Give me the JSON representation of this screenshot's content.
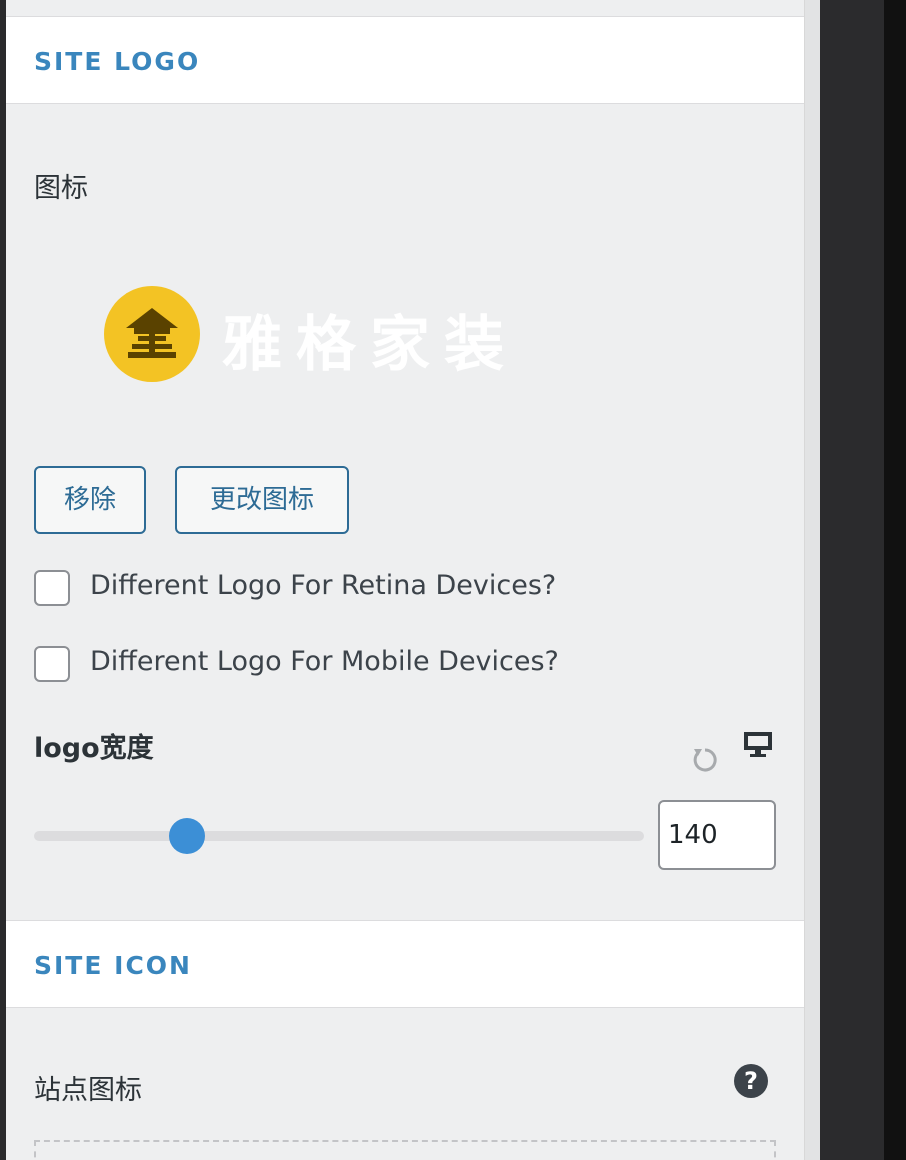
{
  "site_logo_section": {
    "title": "SITE LOGO",
    "logo_label": "图标",
    "logo_image_text": "雅格家装",
    "logo_circle_color": "#f3c324",
    "remove_button": "移除",
    "change_button": "更改图标",
    "retina_checkbox": {
      "label": "Different Logo For Retina Devices?",
      "checked": false
    },
    "mobile_checkbox": {
      "label": "Different Logo For Mobile Devices?",
      "checked": false
    },
    "width_label": "logo宽度",
    "width_value": "140",
    "slider_fraction": 0.25,
    "icons": [
      "reset-icon",
      "desktop-monitor-icon"
    ]
  },
  "site_icon_section": {
    "title": "SITE ICON",
    "icon_label": "站点图标",
    "help_glyph": "?"
  },
  "colors": {
    "accent": "#3a86bd",
    "slider_thumb": "#3c8fd6",
    "button_text": "#2d6b95"
  }
}
